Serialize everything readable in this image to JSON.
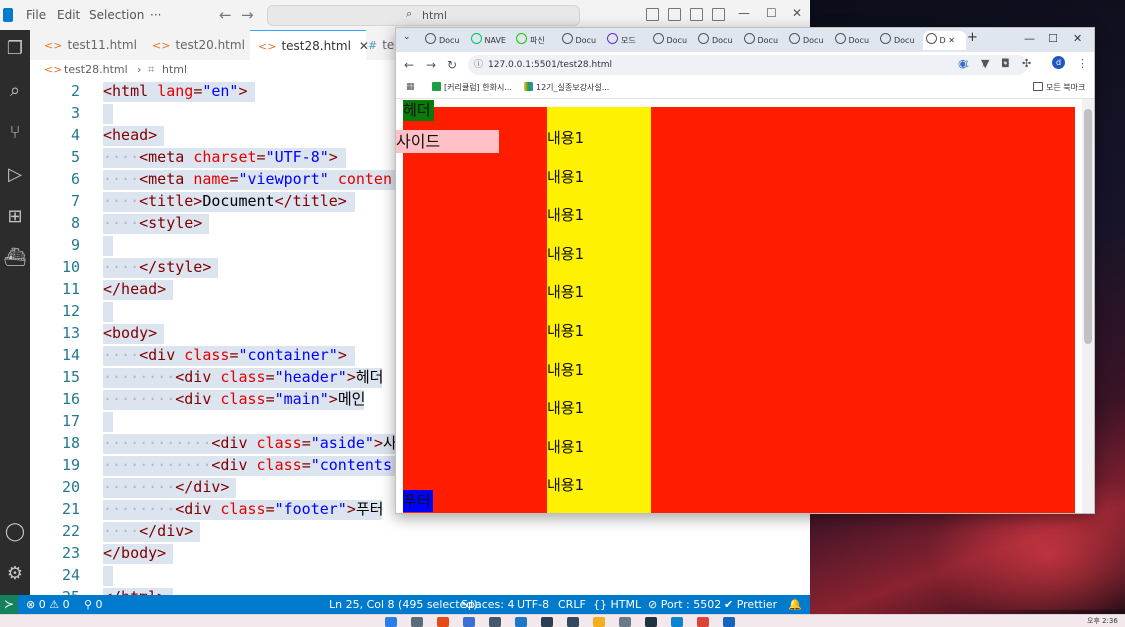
{
  "vscode": {
    "menu": [
      "File",
      "Edit",
      "Selection",
      "···"
    ],
    "command_center": "html",
    "tabs": [
      {
        "label": "test11.html",
        "active": false
      },
      {
        "label": "test20.html",
        "active": false
      },
      {
        "label": "test28.html",
        "active": true
      },
      {
        "label": "te",
        "active": false
      }
    ],
    "breadcrumb": {
      "file": "test28.html",
      "separator": "›",
      "node": "html"
    },
    "lines": [
      {
        "n": "2",
        "tokens": [
          [
            "t",
            "<"
          ],
          [
            "t",
            "html"
          ],
          [
            "s",
            " "
          ],
          [
            "a",
            "lang"
          ],
          [
            "t",
            "="
          ],
          [
            "v",
            "\"en\""
          ],
          [
            "t",
            ">"
          ]
        ]
      },
      {
        "n": "3",
        "tokens": []
      },
      {
        "n": "4",
        "tokens": [
          [
            "t",
            "<head>"
          ]
        ]
      },
      {
        "n": "5",
        "tokens": [
          [
            "d",
            "····"
          ],
          [
            "t",
            "<meta "
          ],
          [
            "a",
            "charset"
          ],
          [
            "t",
            "="
          ],
          [
            "v",
            "\"UTF-8\""
          ],
          [
            "t",
            ">"
          ]
        ]
      },
      {
        "n": "6",
        "tokens": [
          [
            "d",
            "····"
          ],
          [
            "t",
            "<meta "
          ],
          [
            "a",
            "name"
          ],
          [
            "t",
            "="
          ],
          [
            "v",
            "\"viewport\""
          ],
          [
            "s",
            " "
          ],
          [
            "a",
            "conten"
          ]
        ]
      },
      {
        "n": "7",
        "tokens": [
          [
            "d",
            "····"
          ],
          [
            "t",
            "<title>"
          ],
          [
            "x",
            "Document"
          ],
          [
            "t",
            "</title>"
          ]
        ]
      },
      {
        "n": "8",
        "tokens": [
          [
            "d",
            "····"
          ],
          [
            "t",
            "<style>"
          ]
        ]
      },
      {
        "n": "9",
        "tokens": []
      },
      {
        "n": "10",
        "tokens": [
          [
            "d",
            "····"
          ],
          [
            "t",
            "</style>"
          ]
        ]
      },
      {
        "n": "11",
        "tokens": [
          [
            "t",
            "</head>"
          ]
        ]
      },
      {
        "n": "12",
        "tokens": []
      },
      {
        "n": "13",
        "tokens": [
          [
            "t",
            "<body>"
          ]
        ]
      },
      {
        "n": "14",
        "tokens": [
          [
            "d",
            "····"
          ],
          [
            "t",
            "<div "
          ],
          [
            "a",
            "class"
          ],
          [
            "t",
            "="
          ],
          [
            "v",
            "\"container\""
          ],
          [
            "t",
            ">"
          ]
        ]
      },
      {
        "n": "15",
        "tokens": [
          [
            "d",
            "········"
          ],
          [
            "t",
            "<div "
          ],
          [
            "a",
            "class"
          ],
          [
            "t",
            "="
          ],
          [
            "v",
            "\"header\""
          ],
          [
            "t",
            ">"
          ],
          [
            "x",
            "헤더"
          ]
        ]
      },
      {
        "n": "16",
        "tokens": [
          [
            "d",
            "········"
          ],
          [
            "t",
            "<div "
          ],
          [
            "a",
            "class"
          ],
          [
            "t",
            "="
          ],
          [
            "v",
            "\"main\""
          ],
          [
            "t",
            ">"
          ],
          [
            "x",
            "메인"
          ]
        ]
      },
      {
        "n": "17",
        "tokens": []
      },
      {
        "n": "18",
        "tokens": [
          [
            "d",
            "············"
          ],
          [
            "t",
            "<div "
          ],
          [
            "a",
            "class"
          ],
          [
            "t",
            "="
          ],
          [
            "v",
            "\"aside\""
          ],
          [
            "t",
            ">"
          ],
          [
            "x",
            "사"
          ]
        ]
      },
      {
        "n": "19",
        "tokens": [
          [
            "d",
            "············"
          ],
          [
            "t",
            "<div "
          ],
          [
            "a",
            "class"
          ],
          [
            "t",
            "="
          ],
          [
            "v",
            "\"contents"
          ]
        ]
      },
      {
        "n": "20",
        "tokens": [
          [
            "d",
            "········"
          ],
          [
            "t",
            "</div>"
          ]
        ]
      },
      {
        "n": "21",
        "tokens": [
          [
            "d",
            "········"
          ],
          [
            "t",
            "<div "
          ],
          [
            "a",
            "class"
          ],
          [
            "t",
            "="
          ],
          [
            "v",
            "\"footer\""
          ],
          [
            "t",
            ">"
          ],
          [
            "x",
            "푸터"
          ]
        ]
      },
      {
        "n": "22",
        "tokens": [
          [
            "d",
            "····"
          ],
          [
            "t",
            "</div>"
          ]
        ]
      },
      {
        "n": "23",
        "tokens": [
          [
            "t",
            "</body>"
          ]
        ]
      },
      {
        "n": "24",
        "tokens": []
      },
      {
        "n": "25",
        "tokens": [
          [
            "t",
            "</html>"
          ]
        ]
      }
    ],
    "status": {
      "errors": "⊗ 0 ⚠ 0",
      "ports": "⚲ 0",
      "position": "Ln 25, Col 8 (495 selected)",
      "spaces": "Spaces: 4",
      "encoding": "UTF-8",
      "eol": "CRLF",
      "language": "{} HTML",
      "port": "⊘ Port : 5502",
      "prettier": "✔ Prettier",
      "bell": "🔔"
    }
  },
  "chrome": {
    "tabs": [
      "Docu",
      "NAVE",
      "파신",
      "Docu",
      "모드",
      "Docu",
      "Docu",
      "Docu",
      "Docu",
      "Docu",
      "Docu",
      "D"
    ],
    "new_tab": "+",
    "url": "127.0.0.1:5501/test28.html",
    "bookmarks": [
      "[커리큘럼] 한화시...",
      "12기_실종보강사설...",
      "모든 북마크"
    ],
    "page": {
      "header": "헤더",
      "aside": "사이드",
      "contents": [
        "내용1",
        "내용1",
        "내용1",
        "내용1",
        "내용1",
        "내용1",
        "내용1",
        "내용1",
        "내용1",
        "내용1"
      ],
      "footer": "푸터"
    }
  },
  "taskbar": {
    "clock": "오후 2:36"
  },
  "colors": {
    "page_red": "#ff1d00",
    "page_yellow": "#fff200",
    "header_green": "#0a7a0a",
    "aside_pink": "#ffc0c6",
    "footer_blue": "#0000ff",
    "statusbar": "#007acc"
  }
}
